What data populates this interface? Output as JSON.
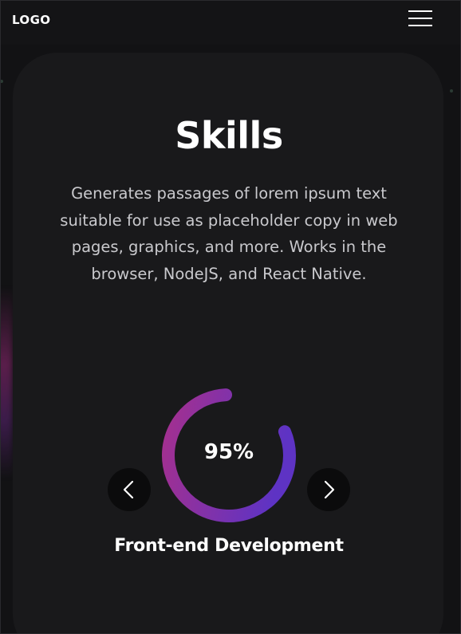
{
  "header": {
    "logo": "LOGO",
    "menu_icon": "hamburger-menu-icon"
  },
  "skills": {
    "title": "Skills",
    "description": "Generates passages of lorem ipsum text suitable for use as placeholder copy in web pages, graphics, and more. Works in the browser, NodeJS, and React Native."
  },
  "carousel": {
    "prev_icon": "chevron-left-icon",
    "next_icon": "chevron-right-icon",
    "current": {
      "name": "Front-end Development",
      "percent_label": "95%",
      "percent": 95
    }
  },
  "colors": {
    "background": "#121214",
    "card": "#19191b",
    "ring_start": "#a4308f",
    "ring_end": "#5e33c4",
    "arrow_button": "#0b0b0c",
    "text": "#ffffff",
    "muted_text": "#c9c9cd"
  }
}
